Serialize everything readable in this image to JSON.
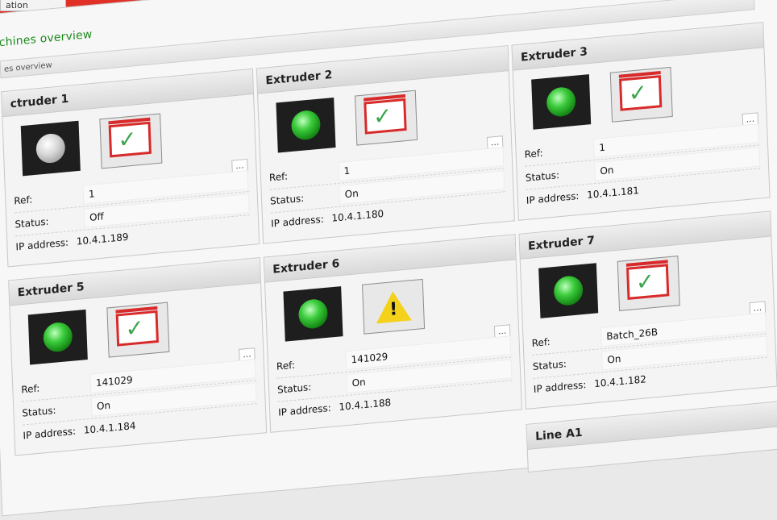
{
  "header": {
    "tab_partial": "ation",
    "section_title": "chines overview",
    "breadcrumb": "es overview"
  },
  "labels": {
    "ref": "Ref:",
    "status": "Status:",
    "ip": "IP address:",
    "more": "..."
  },
  "machines": [
    {
      "title": "ctruder 1",
      "ref": "1",
      "status": "Off",
      "ip": "10.4.1.189",
      "light": "off",
      "state_icon": "ok-check-icon"
    },
    {
      "title": "Extruder 2",
      "ref": "1",
      "status": "On",
      "ip": "10.4.1.180",
      "light": "on",
      "state_icon": "ok-check-icon"
    },
    {
      "title": "Extruder 3",
      "ref": "1",
      "status": "On",
      "ip": "10.4.1.181",
      "light": "on",
      "state_icon": "ok-check-icon"
    },
    {
      "title": "Extruder 5",
      "ref": "141029",
      "status": "On",
      "ip": "10.4.1.184",
      "light": "on",
      "state_icon": "ok-check-icon"
    },
    {
      "title": "Extruder 6",
      "ref": "141029",
      "status": "On",
      "ip": "10.4.1.188",
      "light": "on",
      "state_icon": "warning-icon"
    },
    {
      "title": "Extruder 7",
      "ref": "Batch_26B",
      "status": "On",
      "ip": "10.4.1.182",
      "light": "on",
      "state_icon": "ok-check-icon"
    },
    {
      "title": "Line A1"
    }
  ],
  "colors": {
    "accent_red": "#e03027",
    "title_green": "#1c8a1c",
    "led_on": "#3ccc3c",
    "led_off": "#d8d8d8",
    "warning_yellow": "#f4d21b"
  }
}
